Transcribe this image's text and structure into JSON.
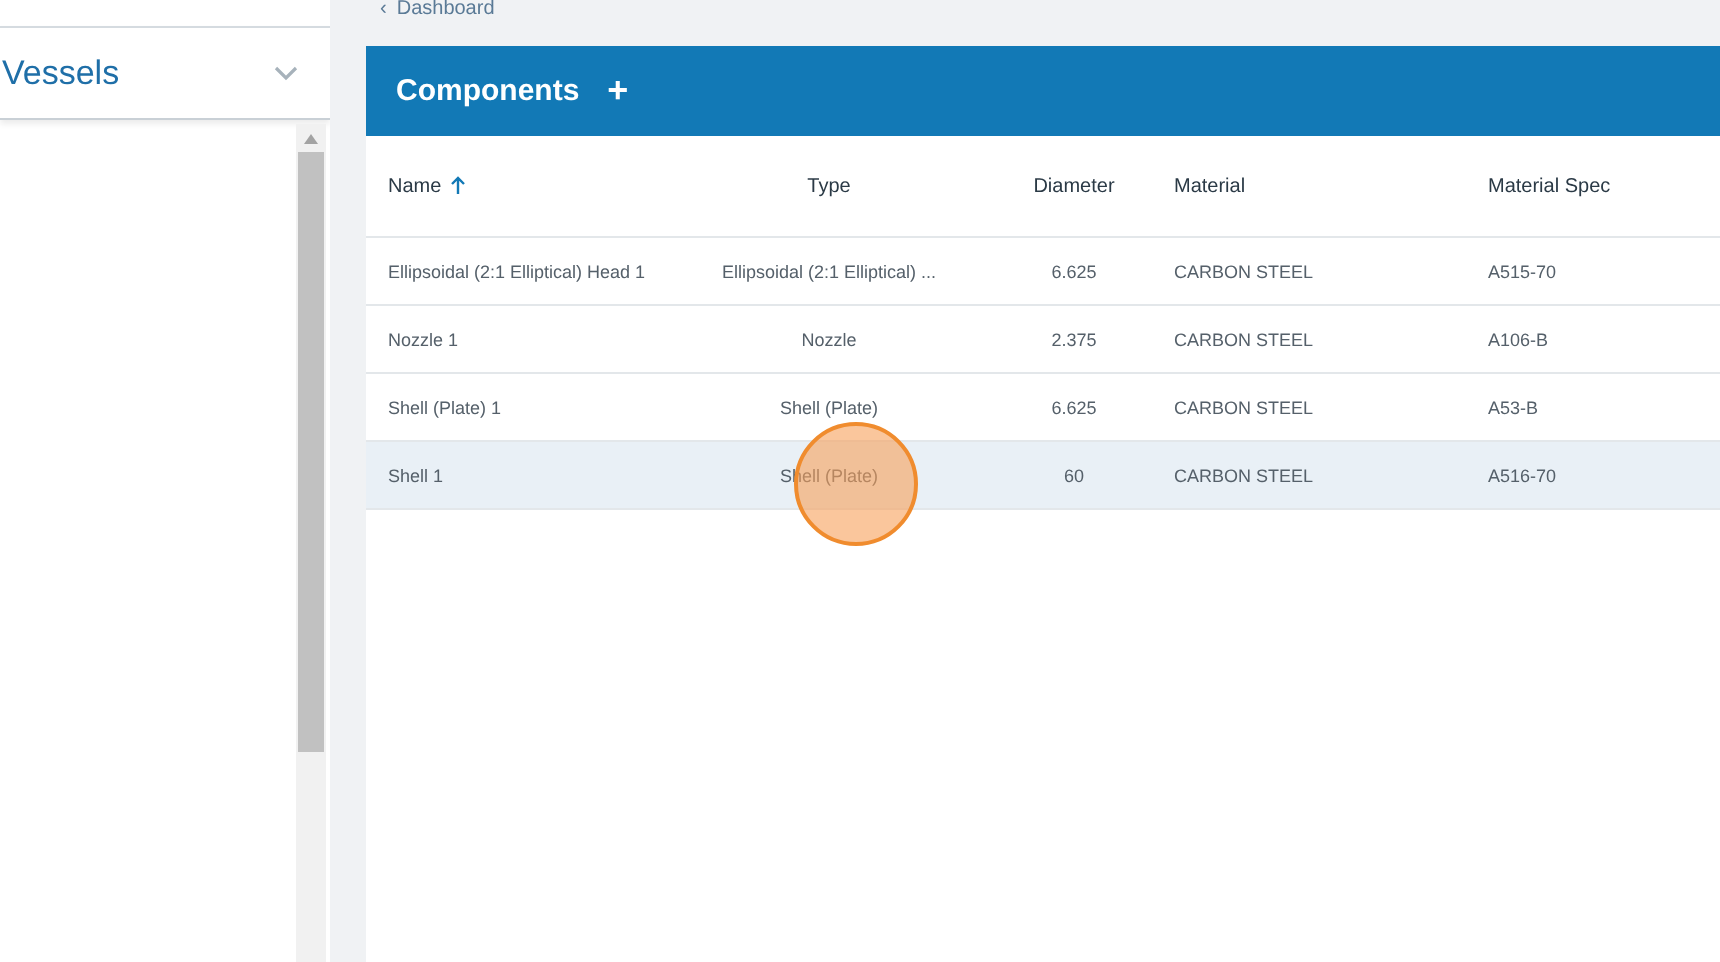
{
  "sidebar": {
    "title": "Vessels",
    "expanded": false
  },
  "breadcrumb": {
    "icon": "‹",
    "label": "Dashboard"
  },
  "panel": {
    "title": "Components",
    "add": "+"
  },
  "table": {
    "columns": [
      {
        "label": "Name",
        "sorted": true
      },
      {
        "label": "Type",
        "sorted": false
      },
      {
        "label": "Diameter",
        "sorted": false
      },
      {
        "label": "Material",
        "sorted": false
      },
      {
        "label": "Material Spec",
        "sorted": false
      }
    ],
    "rows": [
      {
        "cells": [
          "Ellipsoidal (2:1 Elliptical) Head 1",
          "Ellipsoidal (2:1 Elliptical) ...",
          "6.625",
          "CARBON STEEL",
          "A515-70"
        ],
        "selected": false
      },
      {
        "cells": [
          "Nozzle 1",
          "Nozzle",
          "2.375",
          "CARBON STEEL",
          "A106-B"
        ],
        "selected": false
      },
      {
        "cells": [
          "Shell (Plate) 1",
          "Shell (Plate)",
          "6.625",
          "CARBON STEEL",
          "A53-B"
        ],
        "selected": false
      },
      {
        "cells": [
          "Shell 1",
          "Shell (Plate)",
          "60",
          "CARBON STEEL",
          "A516-70"
        ],
        "selected": true
      }
    ]
  },
  "click_marker": {
    "visible": true
  }
}
